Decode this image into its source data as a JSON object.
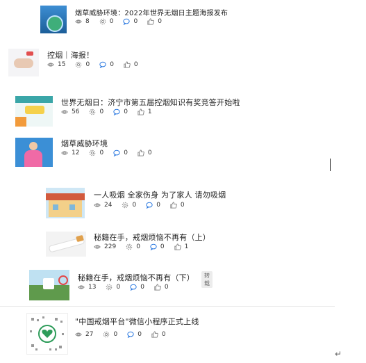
{
  "articles": [
    {
      "title": "烟草威胁环境：2022年世界无烟日主题海报发布",
      "views": "8",
      "shares": "0",
      "comments": "0",
      "likes": "0",
      "thumb_color": "#2a73b8"
    },
    {
      "title": "控烟｜海报！",
      "views": "15",
      "shares": "0",
      "comments": "0",
      "likes": "0",
      "thumb_color": "#d8dde3"
    },
    {
      "title": "世界无烟日：济宁市第五届控烟知识有奖竞答开始啦",
      "views": "56",
      "shares": "0",
      "comments": "0",
      "likes": "1",
      "thumb_color": "#3aa6a8"
    },
    {
      "title": "烟草威胁环境",
      "views": "12",
      "shares": "0",
      "comments": "0",
      "likes": "0",
      "thumb_color": "#3b8fd6"
    },
    {
      "title": "一人吸烟 全家伤身 为了家人 请勿吸烟",
      "views": "24",
      "shares": "0",
      "comments": "0",
      "likes": "0",
      "thumb_color": "#e9c06a"
    },
    {
      "title": "秘籍在手，戒烟烦恼不再有（上）",
      "views": "229",
      "shares": "0",
      "comments": "0",
      "likes": "1",
      "thumb_color": "#e6e6e6"
    },
    {
      "title": "秘籍在手，戒烟烦恼不再有（下）",
      "badge": "转载",
      "views": "13",
      "shares": "0",
      "comments": "0",
      "likes": "0",
      "thumb_color": "#5f9a4c"
    },
    {
      "title": "\"中国戒烟平台\"微信小程序正式上线",
      "views": "27",
      "shares": "0",
      "comments": "0",
      "likes": "0",
      "thumb_color": "#f2f2f2"
    }
  ],
  "return_mark": "↵"
}
